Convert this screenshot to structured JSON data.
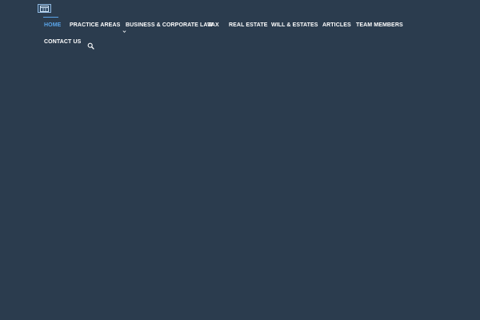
{
  "logo": {
    "icon": "calendar-icon"
  },
  "nav": {
    "items": [
      {
        "label": "HOME",
        "active": true
      },
      {
        "label": "PRACTICE AREAS",
        "has_dropdown": true
      },
      {
        "label": "BUSINESS & CORPORATE LAW"
      },
      {
        "label": "TAX"
      },
      {
        "label": "REAL ESTATE"
      },
      {
        "label": "WILL & ESTATES"
      },
      {
        "label": "ARTICLES"
      },
      {
        "label": "TEAM MEMBERS"
      },
      {
        "label": "CONTACT US"
      }
    ],
    "search_icon": "search-icon"
  },
  "colors": {
    "background": "#2b3c4e",
    "nav_text": "#ffffff",
    "active": "#5aa4e8"
  }
}
